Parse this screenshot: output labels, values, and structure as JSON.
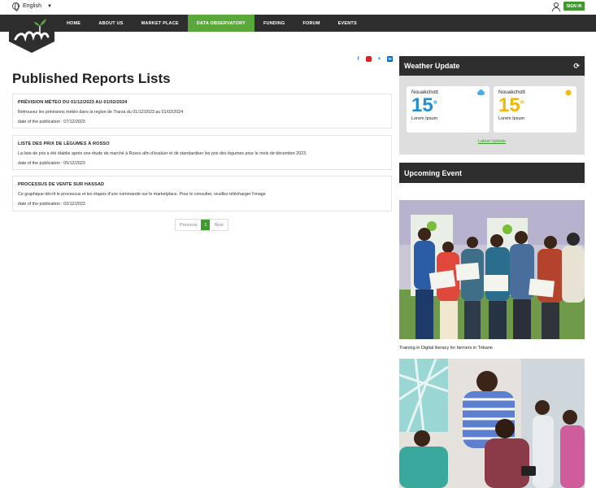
{
  "topbar": {
    "language": "English",
    "signin": "SIGN IN"
  },
  "nav": {
    "items": [
      {
        "label": "HOME"
      },
      {
        "label": "ABOUT US"
      },
      {
        "label": "MARKET PLACE"
      },
      {
        "label": "DATA OBSERVATORY",
        "active": true
      },
      {
        "label": "FUNDING"
      },
      {
        "label": "FORUM"
      },
      {
        "label": "EVENTS"
      }
    ]
  },
  "main": {
    "title": "Published Reports Lists",
    "reports": [
      {
        "title": "PRÉVISION MÉTEO DU 01/12/2023 AU 01/02/2024",
        "description": "Retrouvez les prévisions météo dans la region de Trarza du 01/12/2023 au 01/02/2024",
        "date": "date of the publication : 07/12/2023"
      },
      {
        "title": "LISTE DES PRIX DE LÉGUMES À ROSSO",
        "description": "La liste de prix a été établie après une étude de marché à Rosso afin d'évaluer et de standardiser les prix des légumes pour le mois de décembre 2023.",
        "date": "date of the publication : 05/12/2023"
      },
      {
        "title": "PROCESSUS DE VENTE SUR HASSAD",
        "description": "Ce graphique décrit le processus et les étapes d'une commande sur le marketplace. Pour le consulter, veuillez télécharger l'image",
        "date": "date of the publication : 02/12/2023"
      }
    ],
    "pagination": {
      "previous": "Previous",
      "current": "1",
      "next": "Next"
    }
  },
  "sidebar": {
    "weather": {
      "title": "Weather Update",
      "cards": [
        {
          "city": "Nouakchott",
          "temp": "15",
          "unit": "°",
          "desc": "Lorem Ipsum",
          "icon": "cloud-icon",
          "color": "#1f8ed6"
        },
        {
          "city": "Nouakchott",
          "temp": "15",
          "unit": "°",
          "desc": "Lorem Ipsum",
          "icon": "sun-icon",
          "color": "#f2b705"
        }
      ],
      "latest": "Latest Update"
    },
    "events": {
      "title": "Upcoming Event",
      "items": [
        {
          "caption": "Training in Digital literacy for farmers in Tékane"
        }
      ]
    }
  },
  "colors": {
    "brand_green": "#3f9b2c",
    "nav_active": "#5aa83a",
    "dark": "#2e2e2e"
  }
}
